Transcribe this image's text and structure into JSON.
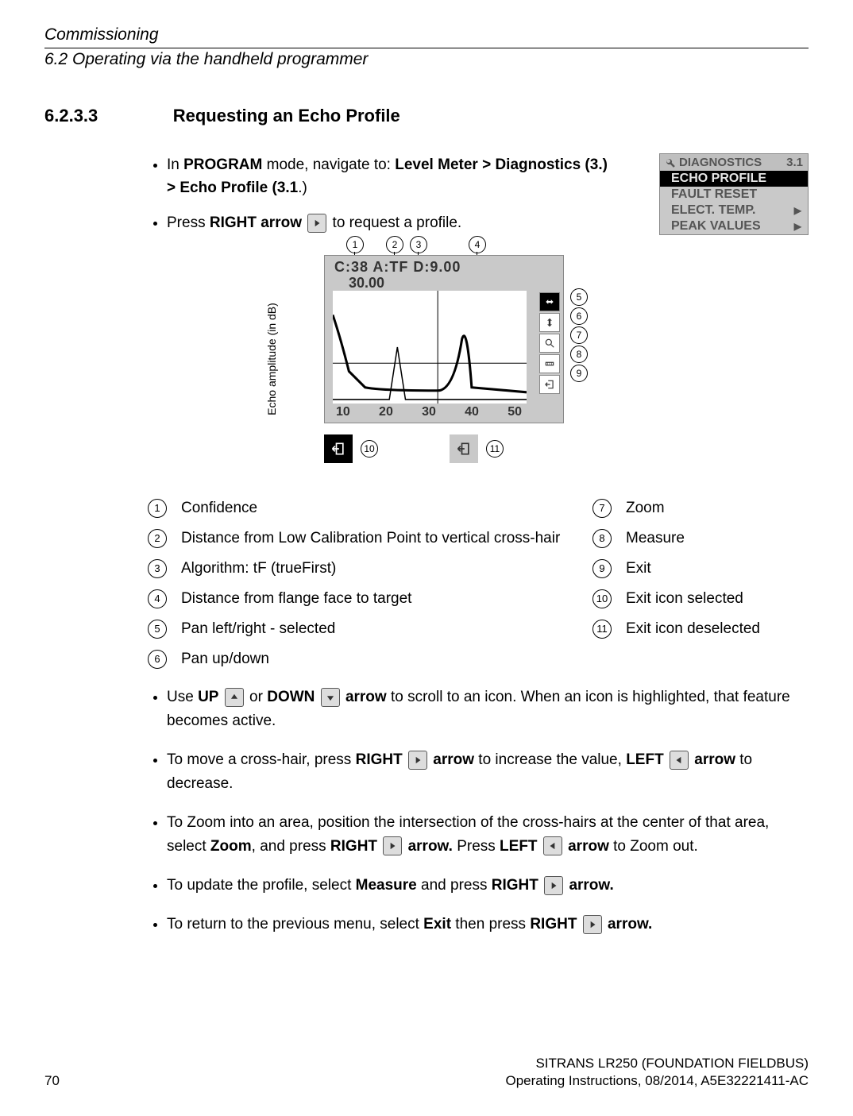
{
  "header": {
    "chapter": "Commissioning",
    "section": "6.2 Operating via the handheld programmer"
  },
  "heading": {
    "number": "6.2.3.3",
    "title": "Requesting an Echo Profile"
  },
  "intro": {
    "b1_pre": "In ",
    "b1_s1": "PROGRAM",
    "b1_mid1": " mode, navigate to: ",
    "b1_s2": "Level Meter > Diagnostics (3.) > Echo Profile (3.1",
    "b1_post": ".)",
    "b2_pre": "Press ",
    "b2_s1": "RIGHT arrow",
    "b2_post": " to request a profile."
  },
  "diag": {
    "title": "DIAGNOSTICS",
    "code": "3.1",
    "items": [
      "ECHO PROFILE",
      "FAULT RESET",
      "ELECT. TEMP.",
      "PEAK VALUES"
    ]
  },
  "figure": {
    "yaxis": "Echo amplitude (in dB)",
    "readout": "C:38   A:TF   D:9.00",
    "readout2": "30.00",
    "ticks": [
      "10",
      "20",
      "30",
      "40",
      "50"
    ],
    "callouts": {
      "1": "1",
      "2": "2",
      "3": "3",
      "4": "4",
      "5": "5",
      "6": "6",
      "7": "7",
      "8": "8",
      "9": "9",
      "10": "10",
      "11": "11"
    }
  },
  "legend": [
    {
      "n": "1",
      "l": "Confidence",
      "n2": "7",
      "r": "Zoom"
    },
    {
      "n": "2",
      "l": "Distance from Low Calibration Point to vertical cross-hair",
      "n2": "8",
      "r": "Measure"
    },
    {
      "n": "3",
      "l": "Algorithm: tF (trueFirst)",
      "n2": "9",
      "r": "Exit"
    },
    {
      "n": "4",
      "l": "Distance from flange face to target",
      "n2": "10",
      "r": "Exit icon selected"
    },
    {
      "n": "5",
      "l": "Pan left/right - selected",
      "n2": "11",
      "r": "Exit icon deselected"
    },
    {
      "n": "6",
      "l": "Pan up/down",
      "n2": "",
      "r": ""
    }
  ],
  "bullets": {
    "u1a": "Use ",
    "u1b": "UP",
    "u1c": " or ",
    "u1d": "DOWN",
    "u1e": " arrow",
    " u1f": " to scroll to an icon. When an icon is highlighted, that feature becomes active.",
    "u2a": "To move a cross-hair, press ",
    "u2b": "RIGHT",
    "u2c": " arrow",
    "u2d": " to increase the value, ",
    "u2e": "LEFT",
    "u2f": " arrow",
    "u2g": " to decrease.",
    "u3a": "To Zoom into an area, position the intersection of the cross-hairs at the center of that area, select ",
    "u3b": "Zoom",
    "u3c": ", and press ",
    "u3d": "RIGHT",
    "u3e": " arrow.",
    "u3f": " Press ",
    "u3g": "LEFT",
    "u3h": " arrow",
    "u3i": " to Zoom out.",
    "u4a": "To update the profile, select ",
    "u4b": "Measure",
    "u4c": " and press ",
    "u4d": "RIGHT",
    "u4e": " arrow.",
    "u5a": "To return to the previous menu, select ",
    "u5b": "Exit",
    "u5c": " then press ",
    "u5d": "RIGHT",
    "u5e": " arrow."
  },
  "footer": {
    "product": "SITRANS LR250 (FOUNDATION FIELDBUS)",
    "page": "70",
    "doc": "Operating Instructions, 08/2014, A5E32221411-AC"
  }
}
